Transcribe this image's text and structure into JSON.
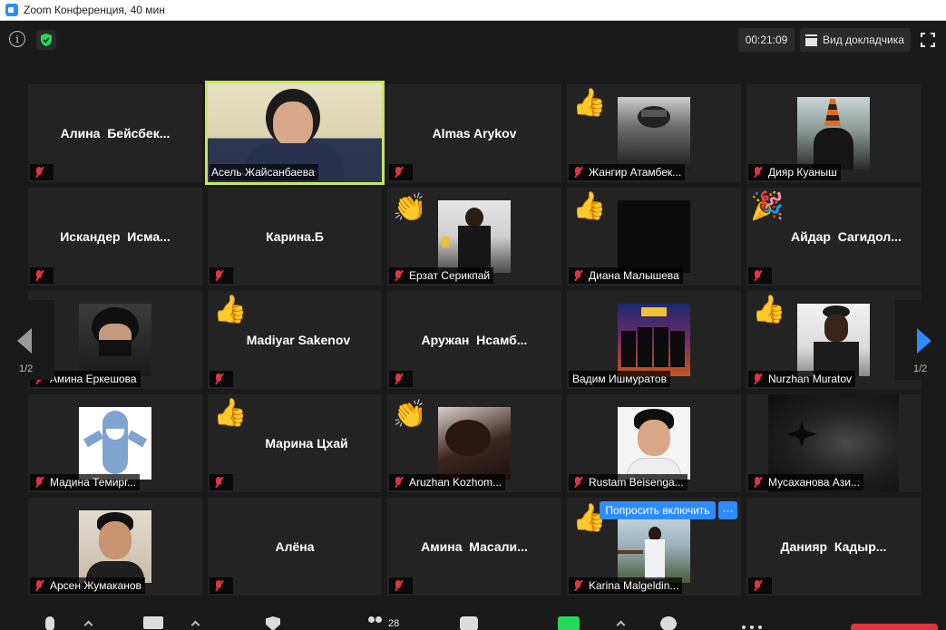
{
  "window": {
    "title": "Zoom Конференция, 40 мин"
  },
  "topbar": {
    "timer": "00:21:09",
    "view_label": "Вид докладчика"
  },
  "pagination": {
    "left_page": "1/2",
    "right_page": "1/2"
  },
  "tiles": [
    {
      "name": "Алина  Бейсбек..."
    },
    {
      "name": "Асель Жайсанбаева"
    },
    {
      "name": "Almas Arykov"
    },
    {
      "name": "Жангир Атамбек..."
    },
    {
      "name": "Дияр Куаныш"
    },
    {
      "name": "Искандер  Исма..."
    },
    {
      "name": "Карина.Б"
    },
    {
      "name": "Ерзат Серикпай"
    },
    {
      "name": "Диана Малышева"
    },
    {
      "name": "Айдар  Сагидол...",
      "name_tag": "Айдар Сагидол..."
    },
    {
      "name": "Амина Еркешова"
    },
    {
      "name": "Madiyar Sakenov"
    },
    {
      "name": "Аружан  Нсамб..."
    },
    {
      "name": "Вадим Ишмуратов"
    },
    {
      "name": "Nurzhan Muratov"
    },
    {
      "name": "Мадина Темирг..."
    },
    {
      "name": "Марина Цхай"
    },
    {
      "name": "Aruzhan Kozhom..."
    },
    {
      "name": "Rustam Beisenga..."
    },
    {
      "name": "Мусаханова Ази..."
    },
    {
      "name": "Арсен Жумаканов"
    },
    {
      "name": "Алёна"
    },
    {
      "name": "Амина  Масали..."
    },
    {
      "name": "Karina Malgeldin..."
    },
    {
      "name": "Данияр  Кадыр..."
    }
  ],
  "request": {
    "ask_label": "Попросить включить",
    "more_label": "···"
  },
  "toolbar": {
    "participants_count": "28"
  },
  "icons": {
    "info": "info-icon",
    "shield": "shield-icon",
    "grid": "grid-icon",
    "fullscreen": "fullscreen-icon",
    "mic_off": "mic-muted-icon",
    "thumbs_up": "👍",
    "clap": "👏",
    "party": "🎉"
  },
  "colors": {
    "accent": "#2d8cff",
    "active_speaker": "#c7e85a",
    "muted": "#e0353f",
    "security": "#23d959"
  }
}
